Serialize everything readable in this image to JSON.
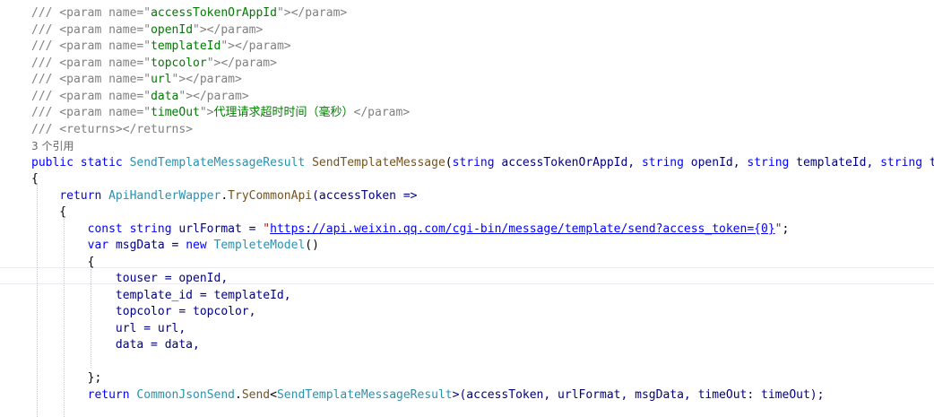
{
  "editor": {
    "lines": [
      [
        {
          "t": "/// <param name=\"",
          "c": "xml"
        },
        {
          "t": "accessTokenOrAppId",
          "c": "cstr"
        },
        {
          "t": "\"></param>",
          "c": "xml"
        }
      ],
      [
        {
          "t": "/// <param name=\"",
          "c": "xml"
        },
        {
          "t": "openId",
          "c": "cstr"
        },
        {
          "t": "\"></param>",
          "c": "xml"
        }
      ],
      [
        {
          "t": "/// <param name=\"",
          "c": "xml"
        },
        {
          "t": "templateId",
          "c": "cstr"
        },
        {
          "t": "\"></param>",
          "c": "xml"
        }
      ],
      [
        {
          "t": "/// <param name=\"",
          "c": "xml"
        },
        {
          "t": "topcolor",
          "c": "cstr"
        },
        {
          "t": "\"></param>",
          "c": "xml"
        }
      ],
      [
        {
          "t": "/// <param name=\"",
          "c": "xml"
        },
        {
          "t": "url",
          "c": "cstr"
        },
        {
          "t": "\"></param>",
          "c": "xml"
        }
      ],
      [
        {
          "t": "/// <param name=\"",
          "c": "xml"
        },
        {
          "t": "data",
          "c": "cstr"
        },
        {
          "t": "\"></param>",
          "c": "xml"
        }
      ],
      [
        {
          "t": "/// <param name=\"",
          "c": "xml"
        },
        {
          "t": "timeOut",
          "c": "cstr"
        },
        {
          "t": "\">",
          "c": "xml"
        },
        {
          "t": "代理请求超时时间（毫秒）",
          "c": "cjk"
        },
        {
          "t": "</param>",
          "c": "xml"
        }
      ],
      [
        {
          "t": "/// <returns></returns>",
          "c": "xml"
        }
      ],
      [
        {
          "t": "3 个引用",
          "c": "ref"
        }
      ],
      [
        {
          "t": "public static ",
          "c": "kw"
        },
        {
          "t": "SendTemplateMessageResult",
          "c": "type"
        },
        {
          "t": " ",
          "c": "p"
        },
        {
          "t": "SendTemplateMessage",
          "c": "meth"
        },
        {
          "t": "(",
          "c": "p"
        },
        {
          "t": "string",
          "c": "kw"
        },
        {
          "t": " accessTokenOrAppId, ",
          "c": "id"
        },
        {
          "t": "string",
          "c": "kw"
        },
        {
          "t": " openId, ",
          "c": "id"
        },
        {
          "t": "string",
          "c": "kw"
        },
        {
          "t": " templateId, ",
          "c": "id"
        },
        {
          "t": "string",
          "c": "kw"
        },
        {
          "t": " topco",
          "c": "id"
        }
      ],
      [
        {
          "t": "{",
          "c": "p"
        }
      ],
      [
        {
          "t": "    ",
          "c": "p"
        },
        {
          "t": "return ",
          "c": "kw"
        },
        {
          "t": "ApiHandlerWapper",
          "c": "type"
        },
        {
          "t": ".",
          "c": "p"
        },
        {
          "t": "TryCommonApi",
          "c": "meth"
        },
        {
          "t": "(accessToken =>",
          "c": "id"
        }
      ],
      [
        {
          "t": "    {",
          "c": "p"
        }
      ],
      [
        {
          "t": "        ",
          "c": "p"
        },
        {
          "t": "const string ",
          "c": "kw"
        },
        {
          "t": "urlFormat = ",
          "c": "id"
        },
        {
          "t": "\"",
          "c": "str"
        },
        {
          "t": "https://api.weixin.qq.com/cgi-bin/message/template/send?access_token={0}",
          "c": "url"
        },
        {
          "t": "\"",
          "c": "str"
        },
        {
          "t": ";",
          "c": "p"
        }
      ],
      [
        {
          "t": "        ",
          "c": "p"
        },
        {
          "t": "var ",
          "c": "kw"
        },
        {
          "t": "msgData = ",
          "c": "id"
        },
        {
          "t": "new ",
          "c": "kw"
        },
        {
          "t": "TempleteModel",
          "c": "type"
        },
        {
          "t": "()",
          "c": "p"
        }
      ],
      [
        {
          "t": "        {",
          "c": "p"
        }
      ],
      [
        {
          "t": "            touser = openId,",
          "c": "id"
        }
      ],
      [
        {
          "t": "            template_id = templateId,",
          "c": "id"
        }
      ],
      [
        {
          "t": "            topcolor = topcolor,",
          "c": "id"
        }
      ],
      [
        {
          "t": "            url = url,",
          "c": "id"
        }
      ],
      [
        {
          "t": "            data = data,",
          "c": "id"
        }
      ],
      [
        {
          "t": "",
          "c": "p"
        }
      ],
      [
        {
          "t": "        };",
          "c": "p"
        }
      ],
      [
        {
          "t": "        ",
          "c": "p"
        },
        {
          "t": "return ",
          "c": "kw"
        },
        {
          "t": "CommonJsonSend",
          "c": "type"
        },
        {
          "t": ".",
          "c": "p"
        },
        {
          "t": "Send",
          "c": "meth"
        },
        {
          "t": "<",
          "c": "p"
        },
        {
          "t": "SendTemplateMessageResult",
          "c": "type"
        },
        {
          "t": ">(accessToken, urlFormat, msgData, timeOut: timeOut);",
          "c": "id"
        }
      ],
      [
        {
          "t": "",
          "c": "p"
        }
      ]
    ]
  }
}
